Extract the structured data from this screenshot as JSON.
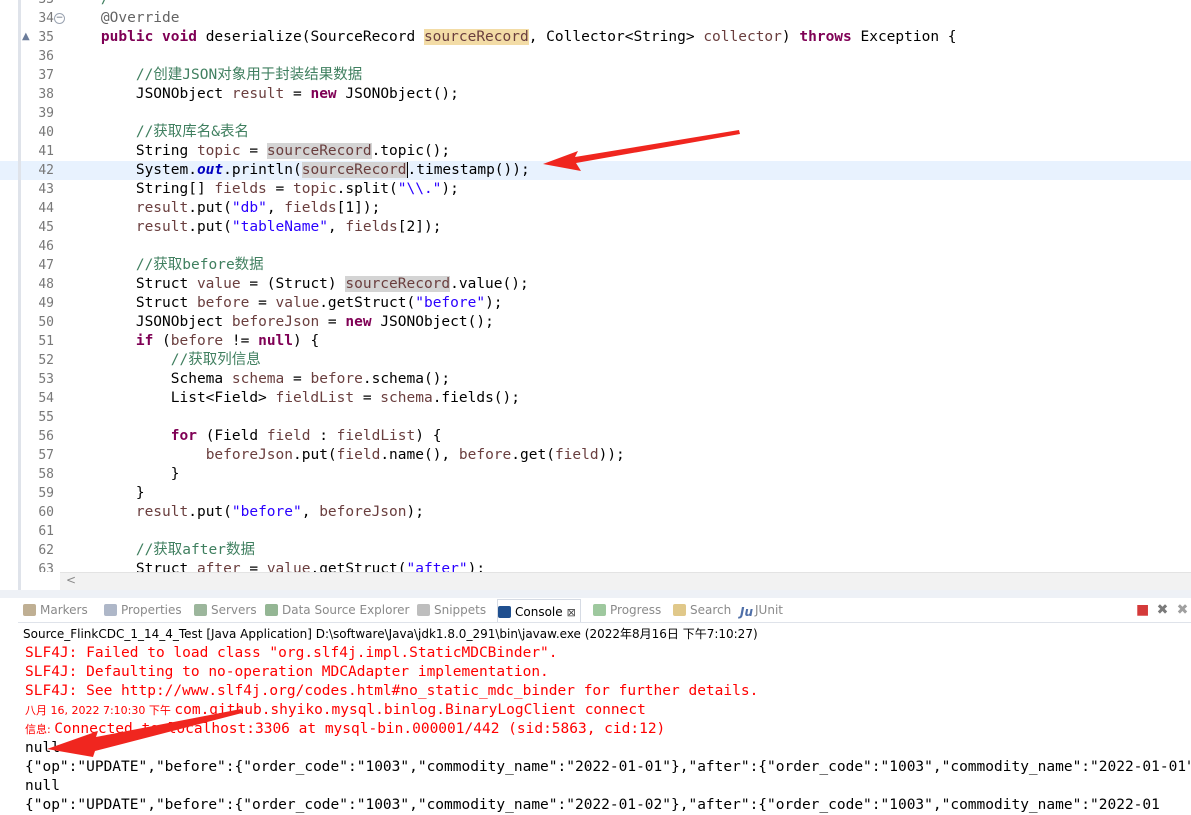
{
  "editor": {
    "lines": [
      {
        "n": "33",
        "marker": "",
        "segs": [
          {
            "t": "   */",
            "c": "cm"
          }
        ]
      },
      {
        "n": "34",
        "marker": "fold",
        "segs": [
          {
            "t": "    "
          },
          {
            "t": "@Override",
            "c": "ann"
          }
        ]
      },
      {
        "n": "35",
        "marker": "override",
        "segs": [
          {
            "t": "    "
          },
          {
            "t": "public",
            "c": "kw"
          },
          {
            "t": " "
          },
          {
            "t": "void",
            "c": "kw"
          },
          {
            "t": " deserialize(SourceRecord "
          },
          {
            "t": "sourceRecord",
            "c": "var pmark"
          },
          {
            "t": ", Collector<String> "
          },
          {
            "t": "collector",
            "c": "var"
          },
          {
            "t": ") "
          },
          {
            "t": "throws",
            "c": "kw"
          },
          {
            "t": " Exception {"
          }
        ]
      },
      {
        "n": "36",
        "segs": []
      },
      {
        "n": "37",
        "segs": [
          {
            "t": "        "
          },
          {
            "t": "//创建JSON对象用于封装结果数据",
            "c": "cm"
          }
        ]
      },
      {
        "n": "38",
        "segs": [
          {
            "t": "        JSONObject "
          },
          {
            "t": "result",
            "c": "var"
          },
          {
            "t": " = "
          },
          {
            "t": "new",
            "c": "kw"
          },
          {
            "t": " JSONObject();"
          }
        ]
      },
      {
        "n": "39",
        "segs": []
      },
      {
        "n": "40",
        "segs": [
          {
            "t": "        "
          },
          {
            "t": "//获取库名&表名",
            "c": "cm"
          }
        ]
      },
      {
        "n": "41",
        "segs": [
          {
            "t": "        String "
          },
          {
            "t": "topic",
            "c": "var"
          },
          {
            "t": " = "
          },
          {
            "t": "sourceRecord",
            "c": "var mark"
          },
          {
            "t": ".topic();"
          }
        ]
      },
      {
        "n": "42",
        "hl": true,
        "segs": [
          {
            "t": "        System."
          },
          {
            "t": "out",
            "c": "sf"
          },
          {
            "t": ".println("
          },
          {
            "t": "sourceRecord",
            "c": "var mark"
          },
          {
            "t": ".timestamp());",
            "c": "caret"
          }
        ]
      },
      {
        "n": "43",
        "segs": [
          {
            "t": "        String[] "
          },
          {
            "t": "fields",
            "c": "var"
          },
          {
            "t": " = "
          },
          {
            "t": "topic",
            "c": "var"
          },
          {
            "t": ".split("
          },
          {
            "t": "\"\\\\.\"",
            "c": "str"
          },
          {
            "t": ");"
          }
        ]
      },
      {
        "n": "44",
        "segs": [
          {
            "t": "        "
          },
          {
            "t": "result",
            "c": "var"
          },
          {
            "t": ".put("
          },
          {
            "t": "\"db\"",
            "c": "str"
          },
          {
            "t": ", "
          },
          {
            "t": "fields",
            "c": "var"
          },
          {
            "t": "[1]);"
          }
        ]
      },
      {
        "n": "45",
        "segs": [
          {
            "t": "        "
          },
          {
            "t": "result",
            "c": "var"
          },
          {
            "t": ".put("
          },
          {
            "t": "\"tableName\"",
            "c": "str"
          },
          {
            "t": ", "
          },
          {
            "t": "fields",
            "c": "var"
          },
          {
            "t": "[2]);"
          }
        ]
      },
      {
        "n": "46",
        "segs": []
      },
      {
        "n": "47",
        "segs": [
          {
            "t": "        "
          },
          {
            "t": "//获取before数据",
            "c": "cm"
          }
        ]
      },
      {
        "n": "48",
        "segs": [
          {
            "t": "        Struct "
          },
          {
            "t": "value",
            "c": "var"
          },
          {
            "t": " = (Struct) "
          },
          {
            "t": "sourceRecord",
            "c": "var mark"
          },
          {
            "t": ".value();"
          }
        ]
      },
      {
        "n": "49",
        "segs": [
          {
            "t": "        Struct "
          },
          {
            "t": "before",
            "c": "var"
          },
          {
            "t": " = "
          },
          {
            "t": "value",
            "c": "var"
          },
          {
            "t": ".getStruct("
          },
          {
            "t": "\"before\"",
            "c": "str"
          },
          {
            "t": ");"
          }
        ]
      },
      {
        "n": "50",
        "segs": [
          {
            "t": "        JSONObject "
          },
          {
            "t": "beforeJson",
            "c": "var"
          },
          {
            "t": " = "
          },
          {
            "t": "new",
            "c": "kw"
          },
          {
            "t": " JSONObject();"
          }
        ]
      },
      {
        "n": "51",
        "segs": [
          {
            "t": "        "
          },
          {
            "t": "if",
            "c": "kw"
          },
          {
            "t": " ("
          },
          {
            "t": "before",
            "c": "var"
          },
          {
            "t": " != "
          },
          {
            "t": "null",
            "c": "kw"
          },
          {
            "t": ") {"
          }
        ]
      },
      {
        "n": "52",
        "segs": [
          {
            "t": "            "
          },
          {
            "t": "//获取列信息",
            "c": "cm"
          }
        ]
      },
      {
        "n": "53",
        "segs": [
          {
            "t": "            Schema "
          },
          {
            "t": "schema",
            "c": "var"
          },
          {
            "t": " = "
          },
          {
            "t": "before",
            "c": "var"
          },
          {
            "t": ".schema();"
          }
        ]
      },
      {
        "n": "54",
        "segs": [
          {
            "t": "            List<Field> "
          },
          {
            "t": "fieldList",
            "c": "var"
          },
          {
            "t": " = "
          },
          {
            "t": "schema",
            "c": "var"
          },
          {
            "t": ".fields();"
          }
        ]
      },
      {
        "n": "55",
        "segs": []
      },
      {
        "n": "56",
        "segs": [
          {
            "t": "            "
          },
          {
            "t": "for",
            "c": "kw"
          },
          {
            "t": " (Field "
          },
          {
            "t": "field",
            "c": "var"
          },
          {
            "t": " : "
          },
          {
            "t": "fieldList",
            "c": "var"
          },
          {
            "t": ") {"
          }
        ]
      },
      {
        "n": "57",
        "segs": [
          {
            "t": "                "
          },
          {
            "t": "beforeJson",
            "c": "var"
          },
          {
            "t": ".put("
          },
          {
            "t": "field",
            "c": "var"
          },
          {
            "t": ".name(), "
          },
          {
            "t": "before",
            "c": "var"
          },
          {
            "t": ".get("
          },
          {
            "t": "field",
            "c": "var"
          },
          {
            "t": "));"
          }
        ]
      },
      {
        "n": "58",
        "segs": [
          {
            "t": "            }"
          }
        ]
      },
      {
        "n": "59",
        "segs": [
          {
            "t": "        }"
          }
        ]
      },
      {
        "n": "60",
        "segs": [
          {
            "t": "        "
          },
          {
            "t": "result",
            "c": "var"
          },
          {
            "t": ".put("
          },
          {
            "t": "\"before\"",
            "c": "str"
          },
          {
            "t": ", "
          },
          {
            "t": "beforeJson",
            "c": "var"
          },
          {
            "t": ");"
          }
        ]
      },
      {
        "n": "61",
        "segs": []
      },
      {
        "n": "62",
        "segs": [
          {
            "t": "        "
          },
          {
            "t": "//获取after数据",
            "c": "cm"
          }
        ]
      },
      {
        "n": "63",
        "segs": [
          {
            "t": "        Struct "
          },
          {
            "t": "after",
            "c": "var"
          },
          {
            "t": " = "
          },
          {
            "t": "value",
            "c": "var"
          },
          {
            "t": ".getStruct("
          },
          {
            "t": "\"after\"",
            "c": "str"
          },
          {
            "t": ");"
          }
        ]
      }
    ],
    "scroll_left_glyph": "<"
  },
  "views": {
    "tabs": [
      {
        "label": "Markers",
        "icon": "markers-icon",
        "color": "#8a6d3b"
      },
      {
        "label": "Properties",
        "icon": "properties-icon",
        "color": "#6b7c9a"
      },
      {
        "label": "Servers",
        "icon": "servers-icon",
        "color": "#4a7a4a"
      },
      {
        "label": "Data Source Explorer",
        "icon": "data-source-explorer-icon",
        "color": "#3d7a3d"
      },
      {
        "label": "Snippets",
        "icon": "snippets-icon",
        "color": "#888888"
      },
      {
        "label": "Console",
        "icon": "console-icon",
        "color": "#1f4f8f",
        "active": true,
        "close": "⊠"
      },
      {
        "label": "Progress",
        "icon": "progress-icon",
        "color": "#4f9a4f"
      },
      {
        "label": "Search",
        "icon": "search-icon",
        "color": "#c79a2a"
      },
      {
        "label": "JUnit",
        "icon": "junit-icon",
        "color": "#4f6fa8",
        "prefix": "Ju"
      }
    ],
    "tools": [
      {
        "name": "terminate-icon",
        "glyph": "■",
        "color": "#d43a3a"
      },
      {
        "name": "remove-launch-icon",
        "glyph": "✖",
        "color": "#7a7a7a"
      },
      {
        "name": "remove-all-terminated-icon",
        "glyph": "✖",
        "color": "#a0a0a0"
      }
    ]
  },
  "console": {
    "header": "Source_FlinkCDC_1_14_4_Test [Java Application] D:\\software\\Java\\jdk1.8.0_291\\bin\\javaw.exe (2022年8月16日 下午7:10:27)",
    "lines": [
      {
        "text": "SLF4J: Failed to load class \"org.slf4j.impl.StaticMDCBinder\".",
        "style": "err"
      },
      {
        "text": "SLF4J: Defaulting to no-operation MDCAdapter implementation.",
        "style": "err"
      },
      {
        "text": "SLF4J: See http://www.slf4j.org/codes.html#no_static_mdc_binder for further details.",
        "style": "err"
      },
      {
        "prefix": "八月 16, 2022 7:10:30 下午 ",
        "text": "com.github.shyiko.mysql.binlog.BinaryLogClient connect",
        "style": "err"
      },
      {
        "prefix": "信息: ",
        "text": "Connected to localhost:3306 at mysql-bin.000001/442 (sid:5863, cid:12)",
        "style": "err"
      },
      {
        "text": "null",
        "style": "out"
      },
      {
        "text": "{\"op\":\"UPDATE\",\"before\":{\"order_code\":\"1003\",\"commodity_name\":\"2022-01-01\"},\"after\":{\"order_code\":\"1003\",\"commodity_name\":\"2022-01-01\"",
        "style": "out"
      },
      {
        "text": "null",
        "style": "out"
      },
      {
        "text": "{\"op\":\"UPDATE\",\"before\":{\"order_code\":\"1003\",\"commodity_name\":\"2022-01-02\"},\"after\":{\"order_code\":\"1003\",\"commodity_name\":\"2022-01",
        "style": "out"
      }
    ]
  },
  "annotations": {
    "arrow_color": "#f0261f"
  }
}
